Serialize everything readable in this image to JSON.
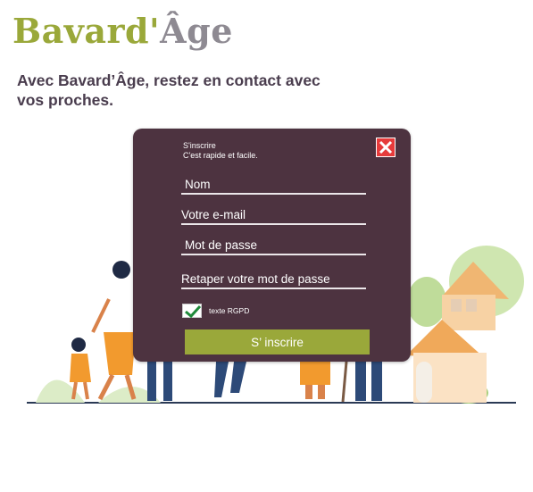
{
  "header": {
    "logo_part1": "Bavard'",
    "logo_part2": "Âge",
    "tagline": "Avec Bavard’Âge, restez en contact avec\n vos proches."
  },
  "modal": {
    "title_line1": "S'inscrire",
    "title_line2": "C'est rapide et facile.",
    "fields": {
      "name": "Nom",
      "email": "Votre e-mail",
      "password": "Mot de passe",
      "password_confirm": "Retaper votre mot de passe"
    },
    "rgpd_label": "texte RGPD",
    "rgpd_checked": true,
    "submit_label": "S’ inscrire"
  },
  "colors": {
    "brand_green": "#9aa83a",
    "panel": "#4d3340",
    "close": "#e63b3b"
  },
  "icons": [
    "close-icon",
    "checkmark-icon"
  ]
}
